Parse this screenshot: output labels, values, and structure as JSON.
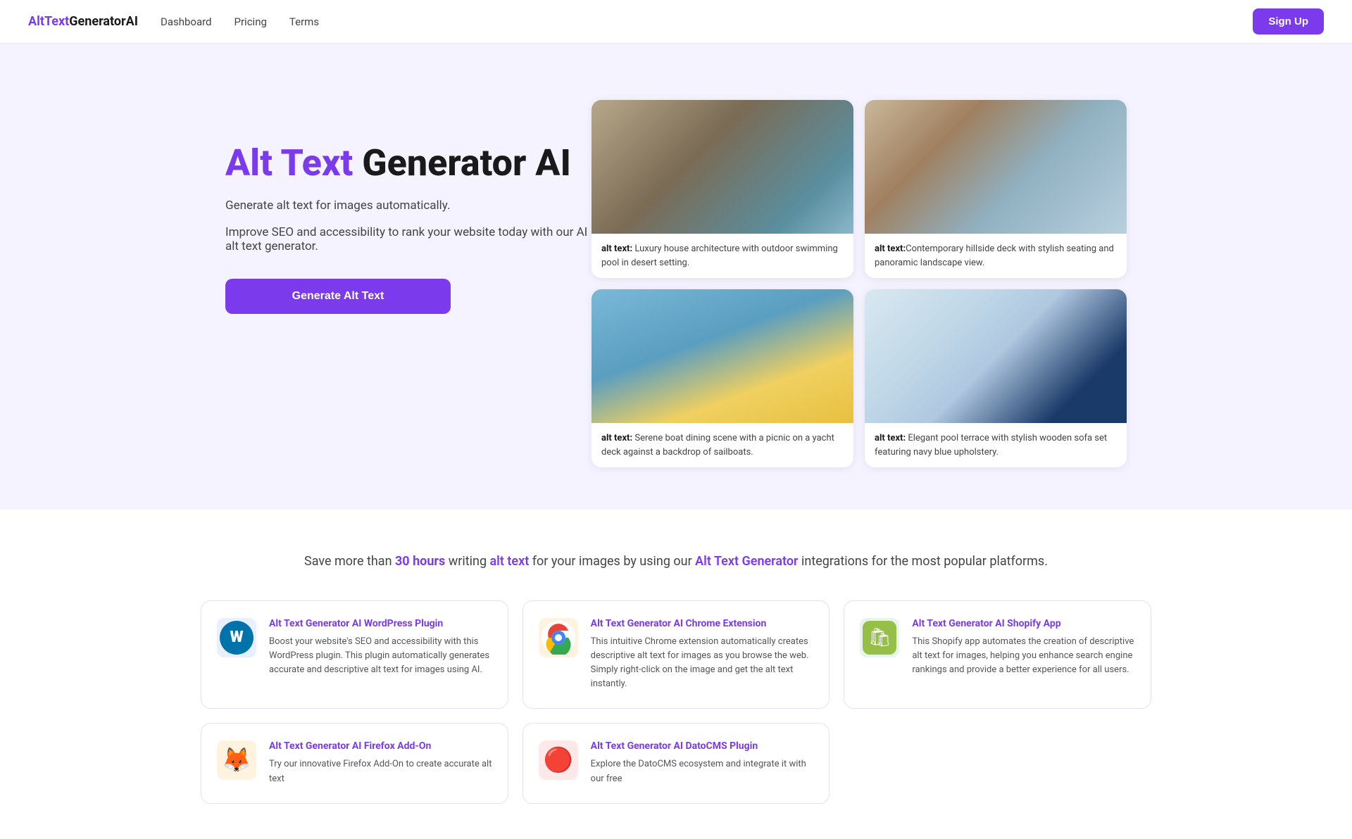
{
  "nav": {
    "logo_alt": "AltText",
    "logo_bold": "GeneratorAI",
    "links": [
      "Dashboard",
      "Pricing",
      "Terms"
    ],
    "signup_label": "Sign Up"
  },
  "hero": {
    "title_alt": "Alt Text",
    "title_rest": " Generator AI",
    "subtitle1": "Generate alt text for images automatically.",
    "subtitle2": "Improve SEO and accessibility to rank your website today with our AI alt text generator.",
    "cta_label": "Generate Alt Text",
    "images": [
      {
        "caption_bold": "alt text:",
        "caption_text": " Luxury house architecture with outdoor swimming pool in desert setting.",
        "color_class": "img-house1"
      },
      {
        "caption_bold": "alt text:",
        "caption_text": "Contemporary hillside deck with stylish seating and panoramic landscape view.",
        "color_class": "img-house2"
      },
      {
        "caption_bold": "alt text:",
        "caption_text": " Serene boat dining scene with a picnic on a yacht deck against a backdrop of sailboats.",
        "color_class": "img-boat"
      },
      {
        "caption_bold": "alt text:",
        "caption_text": " Elegant pool terrace with stylish wooden sofa set featuring navy blue upholstery.",
        "color_class": "img-pool"
      }
    ]
  },
  "integrations": {
    "headline_before": "Save more than ",
    "headline_hours": "30 hours",
    "headline_mid1": " writing ",
    "headline_alt": "alt text",
    "headline_mid2": " for your images by using our ",
    "headline_gen": "Alt Text Generator",
    "headline_after": " integrations for the most popular platforms.",
    "cards": [
      {
        "icon_type": "wp",
        "title": "Alt Text Generator AI WordPress Plugin",
        "desc": "Boost your website's SEO and accessibility with this WordPress plugin. This plugin automatically generates accurate and descriptive alt text for images using AI."
      },
      {
        "icon_type": "chrome",
        "title": "Alt Text Generator AI Chrome Extension",
        "desc": "This intuitive Chrome extension automatically creates descriptive alt text for images as you browse the web. Simply right-click on the image and get the alt text instantly."
      },
      {
        "icon_type": "shopify",
        "title": "Alt Text Generator AI Shopify App",
        "desc": "This Shopify app automates the creation of descriptive alt text for images, helping you enhance search engine rankings and provide a better experience for all users."
      },
      {
        "icon_type": "firefox",
        "title": "Alt Text Generator AI Firefox Add-On",
        "desc": "Try our innovative Firefox Add-On to create accurate alt text"
      },
      {
        "icon_type": "dato",
        "title": "Alt Text Generator AI DatoCMS Plugin",
        "desc": "Explore the DatoCMS ecosystem and integrate it with our free"
      }
    ]
  }
}
